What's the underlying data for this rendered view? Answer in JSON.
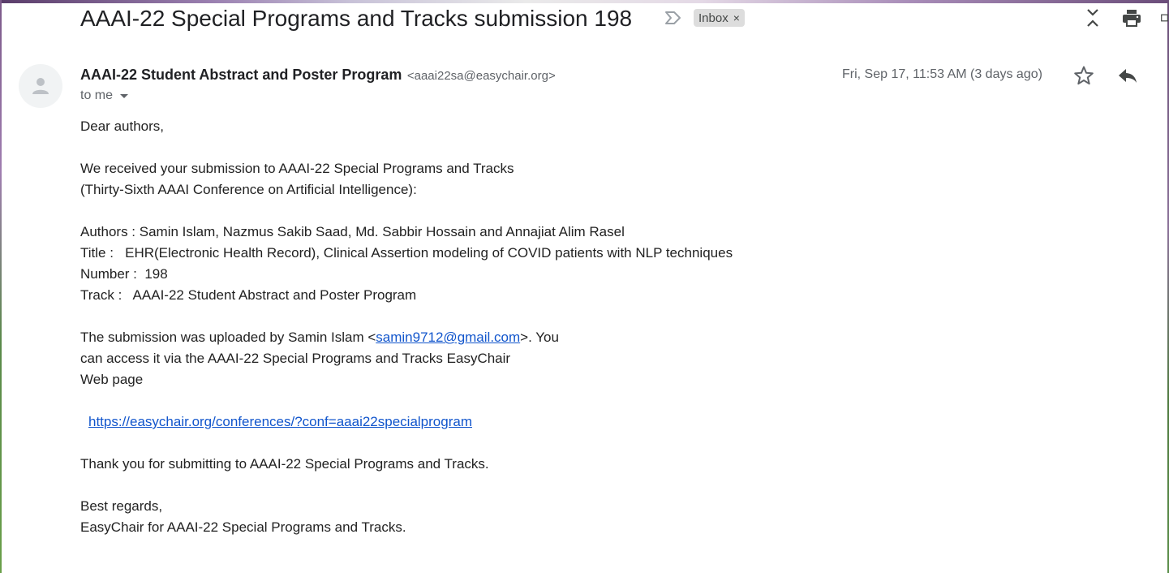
{
  "header": {
    "subject": "AAAI-22 Special Programs and Tracks submission 198",
    "label": "Inbox",
    "label_remove": "×",
    "icons": [
      "importance-marker-icon",
      "collapse-all-icon",
      "print-icon",
      "new-window-icon"
    ]
  },
  "message": {
    "sender_name": "AAAI-22 Student Abstract and Poster Program",
    "sender_email": "<aaai22sa@easychair.org>",
    "recipient": "to me",
    "date": "Fri, Sep 17, 11:53 AM (3 days ago)",
    "icons": [
      "avatar-person-icon",
      "star-icon",
      "reply-icon",
      "caret-down-icon"
    ]
  },
  "body": {
    "greeting": "Dear authors,",
    "intro_1": "We received your submission to AAAI-22 Special Programs and Tracks",
    "intro_2": "(Thirty-Sixth AAAI Conference on Artificial Intelligence):",
    "authors": "Authors : Samin Islam, Nazmus Sakib Saad, Md. Sabbir Hossain and Annajiat Alim Rasel",
    "title": "Title :   EHR(Electronic Health Record), Clinical Assertion modeling of COVID patients with NLP techniques",
    "number": "Number :  198",
    "track": "Track :   AAAI-22 Student Abstract and Poster Program",
    "upload_prefix": "The submission was uploaded by Samin Islam <",
    "upload_email": "samin9712@gmail.com",
    "upload_suffix": ">. You",
    "access_1": "can access it via the AAAI-22 Special Programs and Tracks EasyChair",
    "access_2": "Web page",
    "url": "https://easychair.org/conferences/?conf=aaai22specialprogram",
    "thanks": "Thank you for submitting to AAAI-22 Special Programs and Tracks.",
    "closing_1": "Best regards,",
    "closing_2": "EasyChair for AAAI-22 Special Programs and Tracks."
  }
}
